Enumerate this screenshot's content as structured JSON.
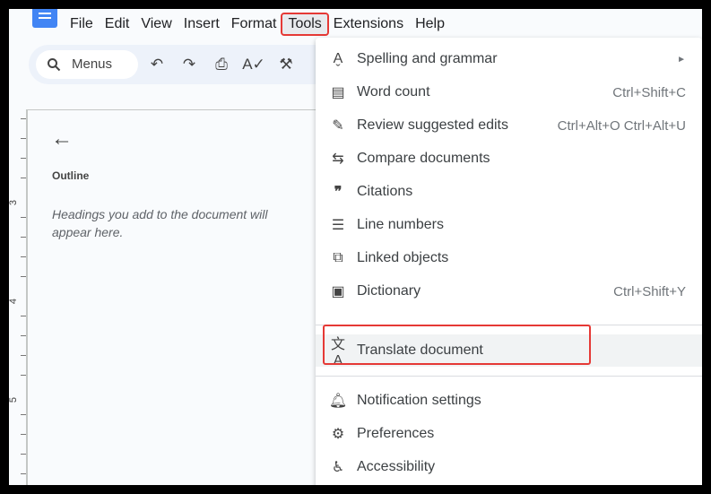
{
  "menubar": {
    "items": [
      "File",
      "Edit",
      "View",
      "Insert",
      "Format",
      "Tools",
      "Extensions",
      "Help"
    ],
    "active": "Tools"
  },
  "toolbar": {
    "search_label": "Menus"
  },
  "ruler": {
    "labels": [
      "3",
      "4",
      "5"
    ]
  },
  "outline": {
    "title": "Outline",
    "hint": "Headings you add to the document will appear here."
  },
  "tools_menu": {
    "items": [
      {
        "label": "Spelling and grammar",
        "shortcut": "►",
        "icon": "spellcheck-icon"
      },
      {
        "label": "Word count",
        "shortcut": "Ctrl+Shift+C",
        "icon": "word-count-icon"
      },
      {
        "label": "Review suggested edits",
        "shortcut": "Ctrl+Alt+O Ctrl+Alt+U",
        "icon": "review-edits-icon"
      },
      {
        "label": "Compare documents",
        "shortcut": "",
        "icon": "compare-icon"
      },
      {
        "label": "Citations",
        "shortcut": "",
        "icon": "quote-icon"
      },
      {
        "label": "Line numbers",
        "shortcut": "",
        "icon": "line-numbers-icon"
      },
      {
        "label": "Linked objects",
        "shortcut": "",
        "icon": "link-icon"
      },
      {
        "label": "Dictionary",
        "shortcut": "Ctrl+Shift+Y",
        "icon": "dictionary-icon"
      },
      {
        "label": "Translate document",
        "shortcut": "",
        "icon": "translate-icon"
      },
      {
        "label": "Notification settings",
        "shortcut": "",
        "icon": "bell-icon"
      },
      {
        "label": "Preferences",
        "shortcut": "",
        "icon": "preferences-icon"
      },
      {
        "label": "Accessibility",
        "shortcut": "",
        "icon": "accessibility-icon"
      }
    ]
  },
  "colors": {
    "highlight": "#e53935",
    "logo": "#4285f4"
  }
}
